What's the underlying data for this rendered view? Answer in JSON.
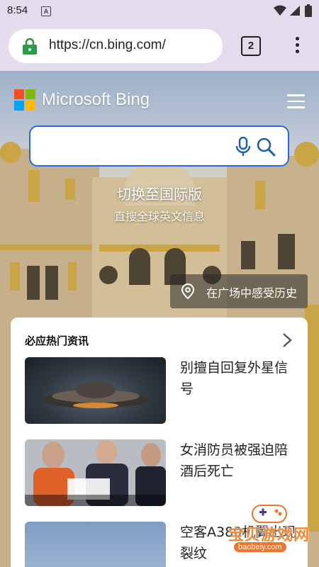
{
  "status_bar": {
    "time": "8:54",
    "notification_icon": "A"
  },
  "browser": {
    "url": "https://cn.bing.com/",
    "tab_count": "2"
  },
  "bing": {
    "logo_text": "Microsoft Bing",
    "search_placeholder": "",
    "switch_intl": "切换至国际版",
    "switch_intl_sub": "直搜全球英文信息",
    "location_chip": "在广场中感受历史"
  },
  "news": {
    "section_title": "必应热门资讯",
    "items": [
      {
        "headline": "别擅自回复外星信号"
      },
      {
        "headline": "女消防员被强迫陪酒后死亡"
      },
      {
        "headline": "空客A380机翼出现裂纹"
      }
    ]
  },
  "watermark": {
    "text": "宝贝游戏网",
    "url": "baobeiy.com"
  },
  "colors": {
    "accent": "#2a6bd4",
    "browser_bar": "#e4dced",
    "lock_green": "#2e9a47"
  }
}
